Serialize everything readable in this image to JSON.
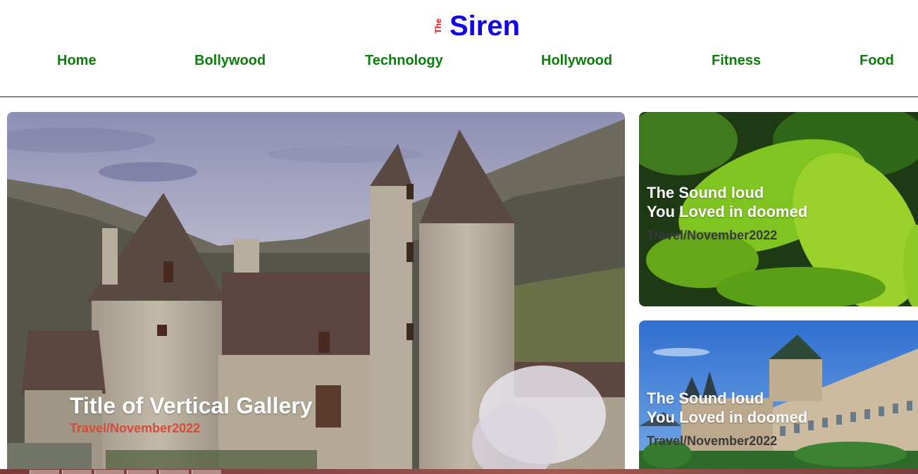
{
  "logo": {
    "the": "The",
    "name": "Siren",
    "the_color": "#e01414",
    "name_color": "#1100e6"
  },
  "nav": {
    "items": [
      {
        "label": "Home"
      },
      {
        "label": "Bollywood"
      },
      {
        "label": "Technology"
      },
      {
        "label": "Hollywood"
      },
      {
        "label": "Fitness"
      },
      {
        "label": "Food"
      }
    ],
    "color": "#0a7d0a"
  },
  "main_card": {
    "title": "Title of Vertical Gallery",
    "meta": "Travel/November2022",
    "image": "castle-photo"
  },
  "side_cards": [
    {
      "title_line1": "The Sound loud",
      "title_line2": "You Loved in doomed",
      "meta": "Travel/November2022",
      "image": "green-leaves-photo"
    },
    {
      "title_line1": "The Sound loud",
      "title_line2": "You Loved in doomed",
      "meta": "Travel/November2022",
      "image": "palace-building-photo"
    }
  ]
}
